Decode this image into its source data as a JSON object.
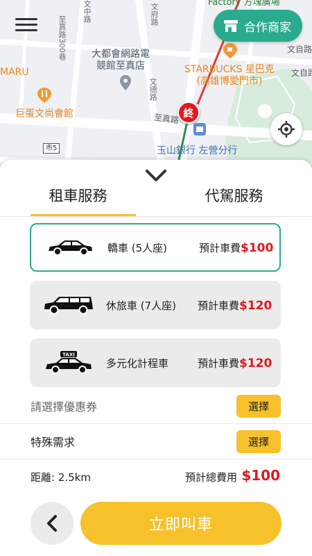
{
  "map": {
    "top_cut_label": "Factory 方塊廣場",
    "poi_network": [
      "大都會網路電",
      "競館至真店"
    ],
    "poi_starbucks": [
      "STARBUCKS 星巴克",
      "(高雄博愛門市)"
    ],
    "poi_maru": "MARU",
    "poi_restaurant": "巨蛋文尚會館",
    "poi_bank": "玉山銀行 左營分行",
    "road_shield": "市5",
    "road_labels": [
      "至真路300巷",
      "文中路",
      "文德路",
      "文府路",
      "至真路",
      "文自路",
      "文自路"
    ]
  },
  "header": {
    "partner_label": "合作商家",
    "end_marker": "終",
    "icons": {
      "menu": "menu-icon",
      "store": "store-icon",
      "locate": "crosshair-icon"
    }
  },
  "tabs": [
    {
      "label": "租車服務",
      "active": true
    },
    {
      "label": "代駕服務",
      "active": false
    }
  ],
  "vehicles": [
    {
      "name": "轎車 (5人座)",
      "fee_label": "預計車費",
      "price": "$100",
      "selected": true,
      "icon": "sedan-icon"
    },
    {
      "name": "休旅車 (7人座)",
      "fee_label": "預計車費",
      "price": "$120",
      "selected": false,
      "icon": "suv-icon"
    },
    {
      "name": "多元化計程車",
      "fee_label": "預計車費",
      "price": "$120",
      "selected": false,
      "icon": "taxi-icon"
    }
  ],
  "taxi_sign": "TAXI",
  "options": {
    "coupon_label": "請選擇優惠券",
    "coupon_button": "選擇",
    "special_label": "特殊需求",
    "special_button": "選擇"
  },
  "summary": {
    "distance": "距離: 2.5km",
    "total_label": "預計總費用",
    "total_price": "$100"
  },
  "actions": {
    "call_label": "立即叫車"
  },
  "colors": {
    "accent_green": "#2aab8e",
    "accent_yellow": "#f7c12b",
    "price_red": "#e0181f"
  }
}
